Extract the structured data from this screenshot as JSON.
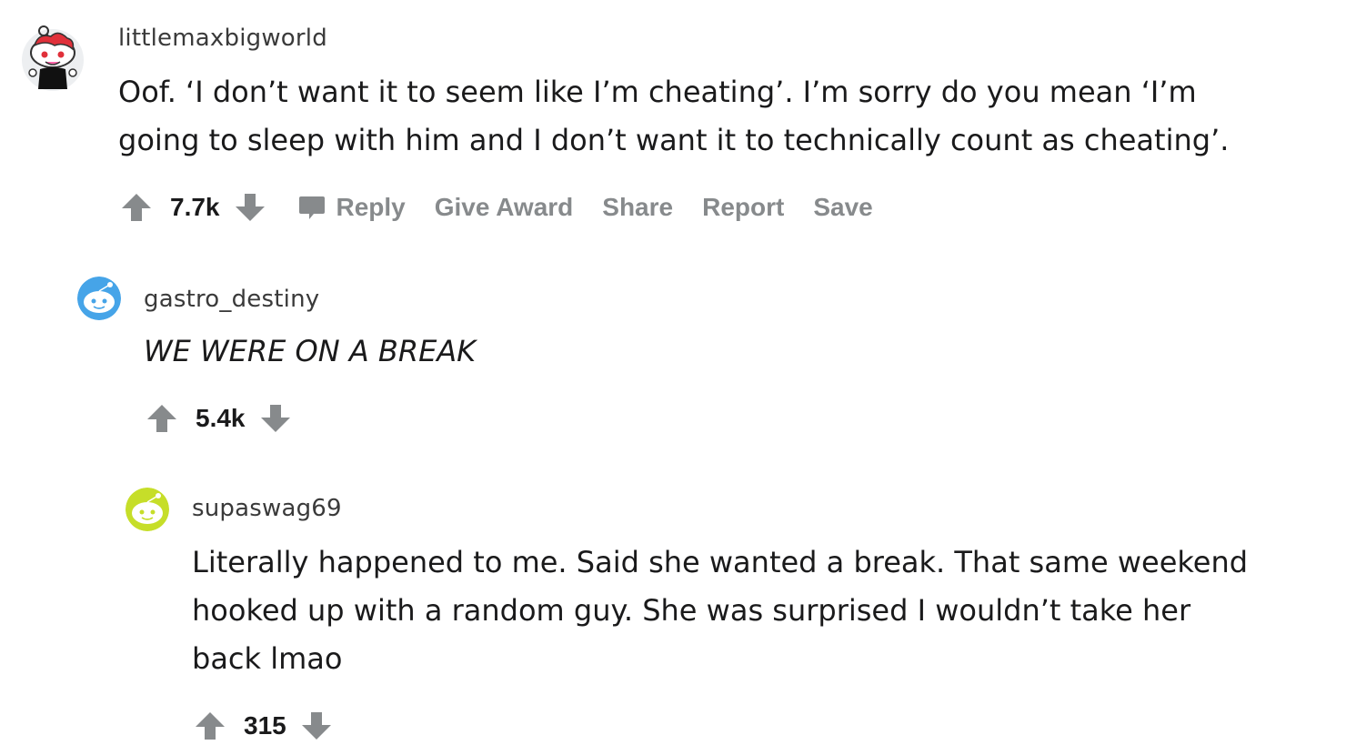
{
  "comments": [
    {
      "username": "littlemaxbigworld",
      "body_lines": [
        "Oof. ‘I don’t want it to seem like I’m cheating’. I’m sorry do you mean ‘I’m",
        "going to sleep with him and I don’t want it to technically count as cheating’."
      ],
      "score": "7.7k",
      "actions": {
        "reply": "Reply",
        "give_award": "Give Award",
        "share": "Share",
        "report": "Report",
        "save": "Save"
      },
      "avatar_icon": "snoo-avatar-red-hair-icon"
    },
    {
      "username": "gastro_destiny",
      "body_lines": [
        "WE WERE ON A BREAK"
      ],
      "score": "5.4k",
      "avatar_icon": "snoo-avatar-blue-icon"
    },
    {
      "username": "supaswag69",
      "body_lines": [
        "Literally happened to me. Said she wanted a break. That same weekend",
        "hooked up with a random guy. She was surprised I wouldn’t take her",
        "back lmao"
      ],
      "score": "315",
      "avatar_icon": "snoo-avatar-yellow-icon"
    }
  ],
  "colors": {
    "text": "#1a1a1b",
    "muted": "#878a8c",
    "vote_arrow": "#878a8c",
    "avatar_blue": "#46a4e8",
    "avatar_yellow": "#c6de29",
    "avatar_red_hair": "#e0303a"
  }
}
